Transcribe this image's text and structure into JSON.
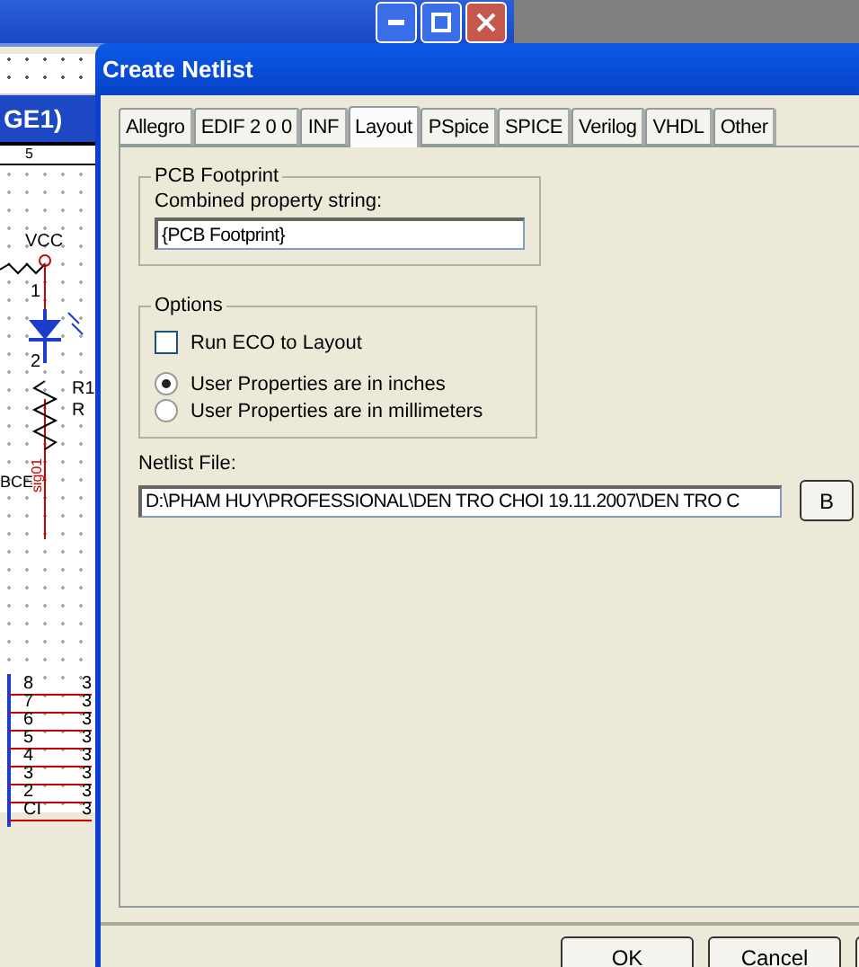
{
  "background_window": {
    "title": "GE1)",
    "ruler_mark": "5",
    "vcc_label": "VCC",
    "pin_labels": [
      "1",
      "2"
    ],
    "part_ref": "R1",
    "part_value": "R",
    "cut_label": "BCE",
    "net_label": "sig01",
    "pin_rows": [
      {
        "number": "8",
        "value": "3"
      },
      {
        "number": "7",
        "value": "3"
      },
      {
        "number": "6",
        "value": "3"
      },
      {
        "number": "5",
        "value": "3"
      },
      {
        "number": "4",
        "value": "3"
      },
      {
        "number": "3",
        "value": "3"
      },
      {
        "number": "2",
        "value": "3"
      },
      {
        "number": "CI",
        "value": "3"
      }
    ]
  },
  "dialog": {
    "title": "Create Netlist",
    "tabs": [
      {
        "label": "Allegro",
        "selected": false
      },
      {
        "label": "EDIF 2 0 0",
        "selected": false
      },
      {
        "label": "INF",
        "selected": false
      },
      {
        "label": "Layout",
        "selected": true
      },
      {
        "label": "PSpice",
        "selected": false
      },
      {
        "label": "SPICE",
        "selected": false
      },
      {
        "label": "Verilog",
        "selected": false
      },
      {
        "label": "VHDL",
        "selected": false
      },
      {
        "label": "Other",
        "selected": false
      }
    ],
    "pcb_footprint": {
      "title": "PCB Footprint",
      "label": "Combined property string:",
      "value": "{PCB Footprint}"
    },
    "options": {
      "title": "Options",
      "run_eco": {
        "label": "Run ECO to Layout",
        "checked": false
      },
      "units": [
        {
          "label": "User Properties are in inches",
          "selected": true
        },
        {
          "label": "User Properties are in millimeters",
          "selected": false
        }
      ]
    },
    "netlist_file": {
      "label": "Netlist File:",
      "value": "D:\\PHAM HUY\\PROFESSIONAL\\DEN TRO CHOI 19.11.2007\\DEN TRO C",
      "browse": "B"
    },
    "buttons": [
      "OK",
      "Cancel"
    ]
  }
}
